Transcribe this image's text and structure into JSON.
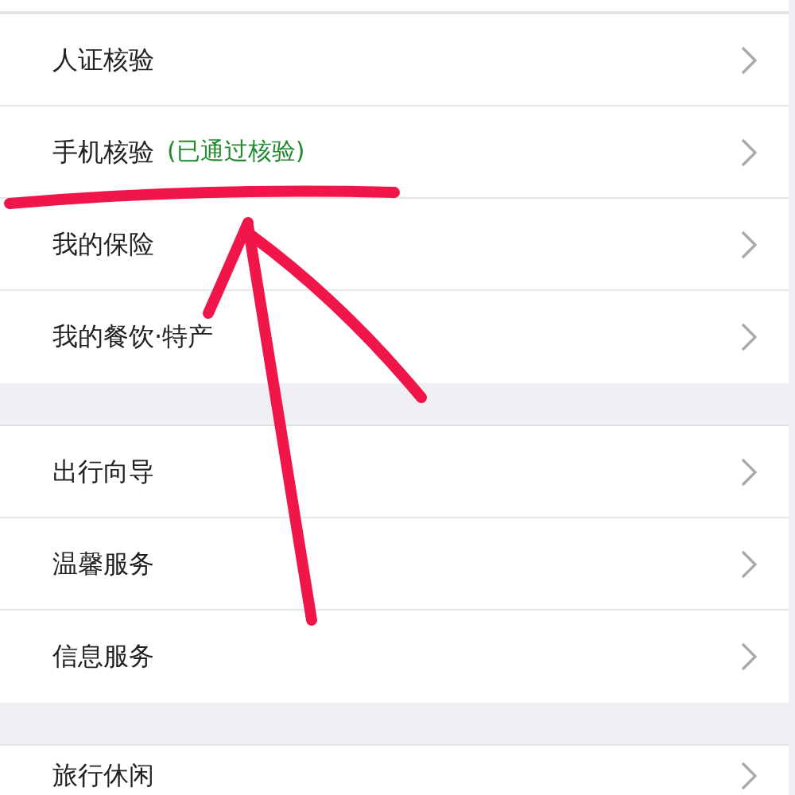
{
  "sections": [
    {
      "items": [
        {
          "label": "人证核验"
        },
        {
          "label": "手机核验",
          "status": "(已通过核验)"
        },
        {
          "label": "我的保险"
        },
        {
          "label": "我的餐饮·特产"
        }
      ]
    },
    {
      "items": [
        {
          "label": "出行向导"
        },
        {
          "label": "温馨服务"
        },
        {
          "label": "信息服务"
        }
      ]
    },
    {
      "items": [
        {
          "label": "旅行休闲"
        }
      ]
    }
  ]
}
